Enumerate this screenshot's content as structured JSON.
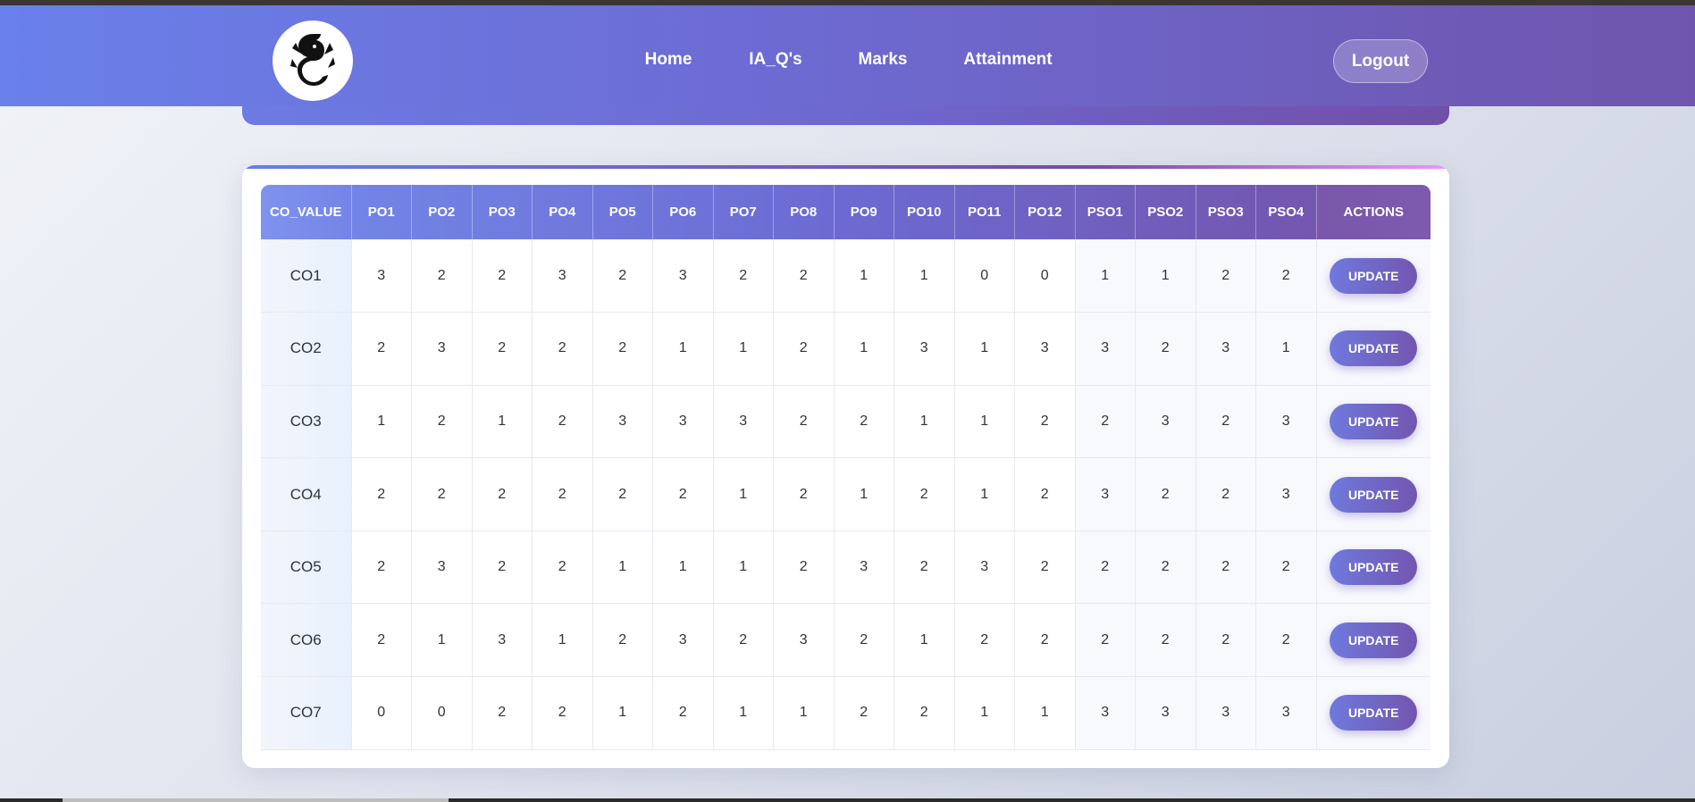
{
  "nav": {
    "links": [
      "Home",
      "IA_Q's",
      "Marks",
      "Attainment"
    ],
    "logout_label": "Logout"
  },
  "table": {
    "headers": [
      "CO_VALUE",
      "PO1",
      "PO2",
      "PO3",
      "PO4",
      "PO5",
      "PO6",
      "PO7",
      "PO8",
      "PO9",
      "PO10",
      "PO11",
      "PO12",
      "PSO1",
      "PSO2",
      "PSO3",
      "PSO4",
      "ACTIONS"
    ],
    "action_label": "UPDATE",
    "rows": [
      {
        "co": "CO1",
        "values": [
          "3",
          "2",
          "2",
          "3",
          "2",
          "3",
          "2",
          "2",
          "1",
          "1",
          "0",
          "0",
          "1",
          "1",
          "2",
          "2"
        ]
      },
      {
        "co": "CO2",
        "values": [
          "2",
          "3",
          "2",
          "2",
          "2",
          "1",
          "1",
          "2",
          "1",
          "3",
          "1",
          "3",
          "3",
          "2",
          "3",
          "1"
        ]
      },
      {
        "co": "CO3",
        "values": [
          "1",
          "2",
          "1",
          "2",
          "3",
          "3",
          "3",
          "2",
          "2",
          "1",
          "1",
          "2",
          "2",
          "3",
          "2",
          "3"
        ]
      },
      {
        "co": "CO4",
        "values": [
          "2",
          "2",
          "2",
          "2",
          "2",
          "2",
          "1",
          "2",
          "1",
          "2",
          "1",
          "2",
          "3",
          "2",
          "2",
          "3"
        ]
      },
      {
        "co": "CO5",
        "values": [
          "2",
          "3",
          "2",
          "2",
          "1",
          "1",
          "1",
          "2",
          "3",
          "2",
          "3",
          "2",
          "2",
          "2",
          "2",
          "2"
        ]
      },
      {
        "co": "CO6",
        "values": [
          "2",
          "1",
          "3",
          "1",
          "2",
          "3",
          "2",
          "3",
          "2",
          "1",
          "2",
          "2",
          "2",
          "2",
          "2",
          "2"
        ]
      },
      {
        "co": "CO7",
        "values": [
          "0",
          "0",
          "2",
          "2",
          "1",
          "2",
          "1",
          "1",
          "2",
          "2",
          "1",
          "1",
          "3",
          "3",
          "3",
          "3"
        ]
      }
    ]
  }
}
